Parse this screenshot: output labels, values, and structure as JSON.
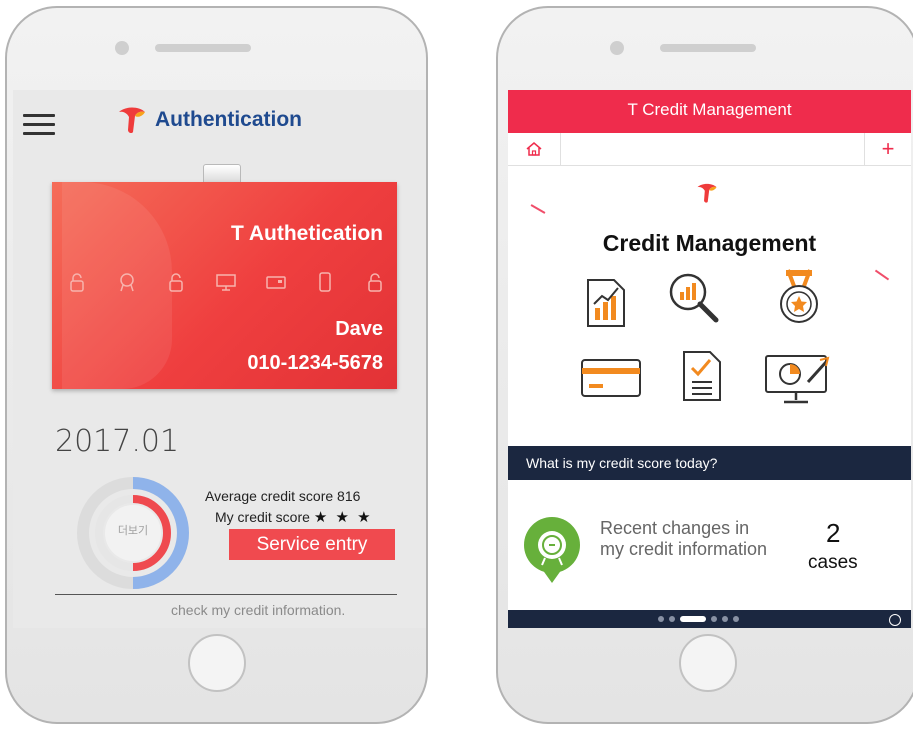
{
  "left_phone": {
    "header": {
      "title": "Authentication"
    },
    "card": {
      "title": "T Authetication",
      "icons": [
        "lock-icon",
        "award-icon",
        "lock-icon",
        "monitor-icon",
        "card-icon",
        "phone-icon",
        "lock-icon"
      ],
      "name": "Dave",
      "phone": "010-1234-5678"
    },
    "date": "2017.01",
    "donut": {
      "label": "더보기",
      "score_fraction": 0.5,
      "colors": {
        "track": "#dcdcdc",
        "outer": "#8fb3ea",
        "inner": "#ef4a4f"
      }
    },
    "score": {
      "average": "Average credit score  816",
      "my_label": "My credit score",
      "stars": "★ ★ ★"
    },
    "service_button": "Service entry",
    "check_link": "check my credit information."
  },
  "right_phone": {
    "app_title": "T Credit Management",
    "plus": "+",
    "section_title": "Credit Management",
    "icons": [
      "report-chart-icon",
      "magnifier-chart-icon",
      "medal-icon",
      "credit-card-icon",
      "checklist-document-icon",
      "monitor-pie-icon"
    ],
    "banner": "What is my credit score today?",
    "changes": {
      "text": "Recent changes in my credit information",
      "count": "2",
      "unit": "cases"
    },
    "colors": {
      "brand": "#ef2c4c",
      "navy": "#1b2740",
      "orange": "#f28a1f"
    }
  }
}
